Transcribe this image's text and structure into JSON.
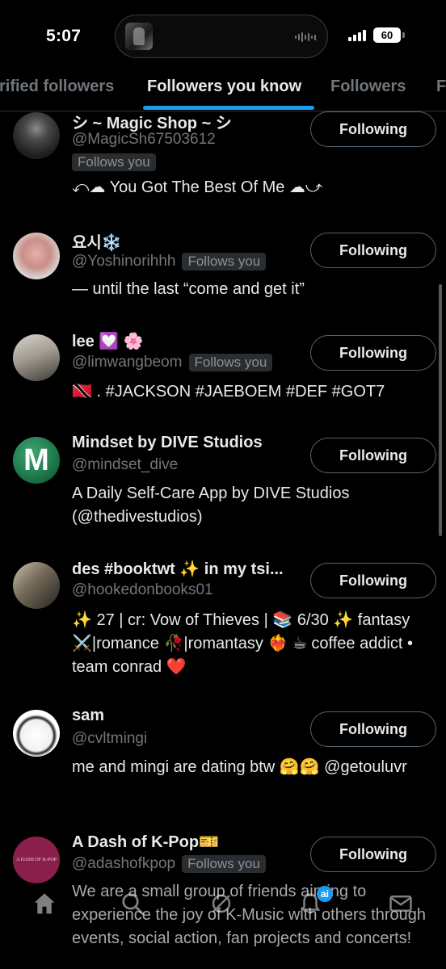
{
  "status_bar": {
    "time": "5:07",
    "battery": "60"
  },
  "tabs": [
    {
      "label": "rified followers"
    },
    {
      "label": "Followers you know"
    },
    {
      "label": "Followers"
    },
    {
      "label": "F"
    }
  ],
  "users": [
    {
      "name": "シ ~ Magic Shop ~ シ",
      "handle": "@MagicSh67503612",
      "follows_you": "Follows you",
      "bio": "⤺☁︎ You Got The Best Of Me ☁︎⤻",
      "button": "Following"
    },
    {
      "name": "요시❄️",
      "handle": "@Yoshinorihhh",
      "follows_you": "Follows you",
      "bio": "— until the last “come and get it”",
      "button": "Following"
    },
    {
      "name": "lee 💟 🌸",
      "handle": "@limwangbeom",
      "follows_you": "Follows you",
      "bio": "🇹🇹 . #JACKSON #JAEBOEM #DEF #GOT7",
      "button": "Following"
    },
    {
      "name": "Mindset by DIVE Studios",
      "handle": "@mindset_dive",
      "bio": "A Daily Self-Care App by DIVE Studios (@thedivestudios)",
      "button": "Following",
      "avatar_letter": "M"
    },
    {
      "name": "des #booktwt ✨ in my tsi...",
      "handle": "@hookedonbooks01",
      "bio": "✨ 27 | cr: Vow of Thieves | 📚 6/30 ✨ fantasy ⚔️|romance 🥀|romantasy ❤️‍🔥 ☕ coffee addict • team conrad ❤️",
      "button": "Following"
    },
    {
      "name": "sam",
      "handle": "@cvltmingi",
      "bio": "me and mingi are dating btw 🤗🤗 @getouluvr",
      "button": "Following"
    },
    {
      "name": "A Dash of K-Pop🎫",
      "handle": "@adashofkpop",
      "follows_you": "Follows you",
      "bio": "We are a small group of friends aiming to experience the joy of K-Music with others through events, social action, fan projects and concerts!",
      "button": "Following",
      "avatar_text": "A DASH OF K-POP"
    }
  ],
  "bottom_nav": {
    "notification_count": "ai"
  },
  "colors": {
    "accent": "#1d9bf0",
    "background": "#000000",
    "muted": "#71767b"
  }
}
